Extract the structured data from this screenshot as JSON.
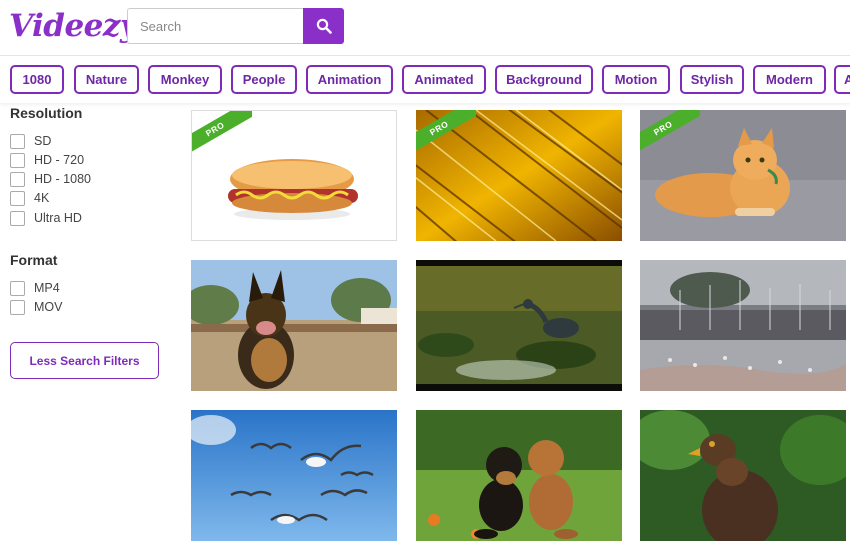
{
  "header": {
    "logo": "Videezy",
    "search_placeholder": "Search",
    "search_value": ""
  },
  "tags": [
    "1080",
    "Nature",
    "Monkey",
    "People",
    "Animation",
    "Animated",
    "Background",
    "Motion",
    "Stylish",
    "Modern",
    "A"
  ],
  "filters": {
    "resolution": {
      "heading": "Resolution",
      "options": [
        "SD",
        "HD - 720",
        "HD - 1080",
        "4K",
        "Ultra HD"
      ]
    },
    "format": {
      "heading": "Format",
      "options": [
        "MP4",
        "MOV"
      ]
    },
    "less_button": "Less Search Filters"
  },
  "videos": [
    {
      "subject": "hot-dog",
      "pro_label": "PRO"
    },
    {
      "subject": "golden-streaks",
      "pro_label": "PRO"
    },
    {
      "subject": "orange-cat",
      "pro_label": "PRO"
    },
    {
      "subject": "german-shepherd-dog"
    },
    {
      "subject": "heron-in-pond"
    },
    {
      "subject": "harbor-with-birds"
    },
    {
      "subject": "seagulls-in-sky"
    },
    {
      "subject": "two-puppies"
    },
    {
      "subject": "eagle"
    }
  ],
  "colors": {
    "brand": "#8b2fc9",
    "tag_border": "#7d2bb8",
    "pro_ribbon": "#4caf2c"
  },
  "icons": {
    "search": "search-icon",
    "tag_scroll": "chevron-right-icon"
  }
}
